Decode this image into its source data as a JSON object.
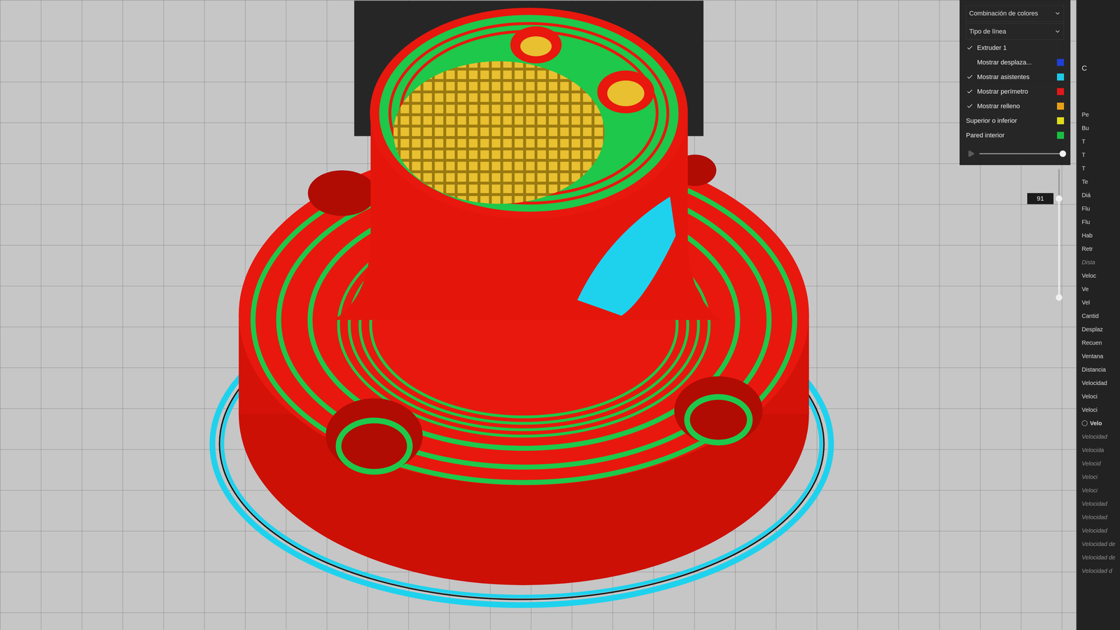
{
  "legend": {
    "color_scheme": {
      "label": "Combinación de colores"
    },
    "line_type": {
      "label": "Tipo de línea"
    },
    "items": [
      {
        "label": "Extruder 1",
        "kind": "check",
        "checked": true
      },
      {
        "label": "Mostrar desplaza...",
        "kind": "check",
        "checked": false,
        "color": "#1f3fd6"
      },
      {
        "label": "Mostrar asistentes",
        "kind": "check",
        "checked": true,
        "color": "#1fc8e8"
      },
      {
        "label": "Mostrar perímetro",
        "kind": "check",
        "checked": true,
        "color": "#e01818"
      },
      {
        "label": "Mostrar relleno",
        "kind": "check",
        "checked": true,
        "color": "#e8a018"
      },
      {
        "label": "Superior o inferior",
        "kind": "plain",
        "color": "#e0dc20"
      },
      {
        "label": "Pared interior",
        "kind": "plain",
        "color": "#18c040"
      }
    ]
  },
  "playback": {
    "level": 1
  },
  "layer_slider": {
    "value": "91",
    "level": 0.77,
    "lower_level": 0
  },
  "settings": {
    "heading": "C",
    "items": [
      {
        "label": "Pe",
        "kind": "setting",
        "disabled": false
      },
      {
        "label": "Bu",
        "kind": "setting",
        "disabled": false
      },
      {
        "label": "T",
        "kind": "setting",
        "disabled": false
      },
      {
        "label": "T",
        "kind": "setting",
        "disabled": false
      },
      {
        "label": "T",
        "kind": "setting",
        "disabled": false
      },
      {
        "label": "Te",
        "kind": "setting",
        "disabled": false
      },
      {
        "label": "Diá",
        "kind": "setting",
        "disabled": false
      },
      {
        "label": "Flu",
        "kind": "setting",
        "disabled": false
      },
      {
        "label": "Flu",
        "kind": "setting",
        "disabled": false
      },
      {
        "label": "Hab",
        "kind": "setting",
        "disabled": false
      },
      {
        "label": "Retr",
        "kind": "setting",
        "disabled": false
      },
      {
        "label": "Dista",
        "kind": "setting",
        "disabled": true
      },
      {
        "label": "Veloc",
        "kind": "setting",
        "disabled": false
      },
      {
        "label": "Ve",
        "kind": "setting",
        "disabled": false
      },
      {
        "label": "Vel",
        "kind": "setting",
        "disabled": false
      },
      {
        "label": "Cantid",
        "kind": "setting",
        "disabled": false
      },
      {
        "label": "Desplaz",
        "kind": "setting",
        "disabled": false
      },
      {
        "label": "Recuen",
        "kind": "setting",
        "disabled": false
      },
      {
        "label": "Ventana",
        "kind": "setting",
        "disabled": false
      },
      {
        "label": "Distancia",
        "kind": "setting",
        "disabled": false
      },
      {
        "label": "Velocidad",
        "kind": "setting",
        "disabled": false
      },
      {
        "label": "Veloci",
        "kind": "setting",
        "disabled": false
      },
      {
        "label": "Veloci",
        "kind": "setting",
        "disabled": false
      },
      {
        "label": "Velo",
        "kind": "group",
        "disabled": false
      },
      {
        "label": "Velocidad",
        "kind": "setting",
        "disabled": true
      },
      {
        "label": "Velocida",
        "kind": "setting",
        "disabled": true
      },
      {
        "label": "Velocid",
        "kind": "setting",
        "disabled": true
      },
      {
        "label": "Veloci",
        "kind": "setting",
        "disabled": true
      },
      {
        "label": "Veloci",
        "kind": "setting",
        "disabled": true
      },
      {
        "label": "Velocidad",
        "kind": "setting",
        "disabled": true
      },
      {
        "label": "Velocidad",
        "kind": "setting",
        "disabled": true
      },
      {
        "label": "Velocidad",
        "kind": "setting",
        "disabled": true
      },
      {
        "label": "Velocidad de",
        "kind": "setting",
        "disabled": true
      },
      {
        "label": "Velocidad de",
        "kind": "setting",
        "disabled": true
      },
      {
        "label": "Velocidad d",
        "kind": "setting",
        "disabled": true
      }
    ]
  }
}
